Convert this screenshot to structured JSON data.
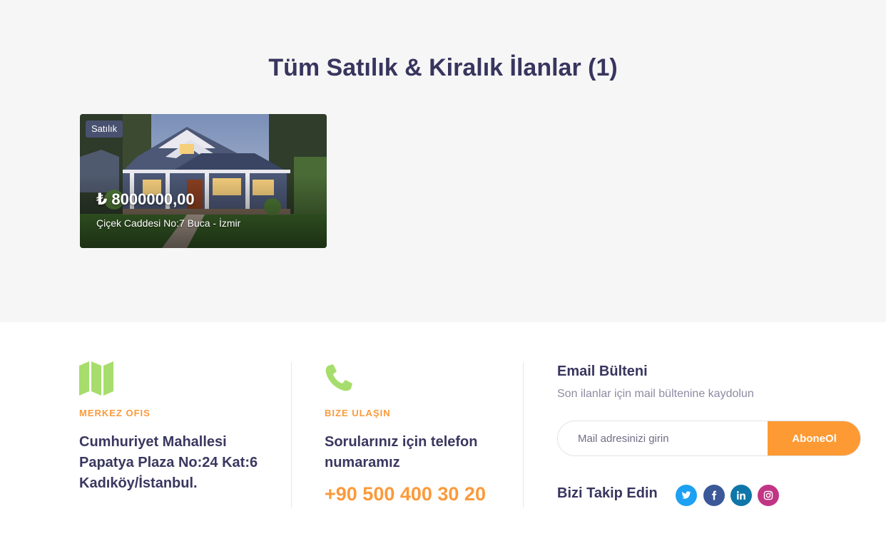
{
  "listings_section": {
    "title": "Tüm Satılık & Kiralık İlanlar (1)",
    "listings": [
      {
        "badge": "Satılık",
        "price": "₺ 8000000,00",
        "address": "Çiçek Caddesi No:7 Buca - İzmir"
      }
    ]
  },
  "footer": {
    "office": {
      "icon": "map-icon",
      "label": "MERKEZ OFIS",
      "address_lines": [
        "Cumhuriyet Mahallesi",
        "Papatya Plaza No:24 Kat:6",
        "Kadıköy/İstanbul."
      ]
    },
    "contact": {
      "icon": "phone-icon",
      "label": "BIZE ULAŞIN",
      "text_lines": [
        "Sorularınız için telefon",
        "numaramız"
      ],
      "phone": "+90 500 400 30 20"
    },
    "newsletter": {
      "title": "Email Bülteni",
      "subtitle": "Son ilanlar için mail bültenine kaydolun",
      "placeholder": "Mail adresinizi girin",
      "button": "AboneOl"
    },
    "follow": {
      "title": "Bizi Takip Edin",
      "networks": [
        {
          "icon": "twitter-icon",
          "color": "#1da1f2"
        },
        {
          "icon": "facebook-icon",
          "color": "#3b5998"
        },
        {
          "icon": "linkedin-icon",
          "color": "#0e76a8"
        },
        {
          "icon": "instagram-icon",
          "color": "#c13584"
        }
      ]
    }
  },
  "colors": {
    "accent_orange": "#fb9a3b",
    "icon_green": "#a6dd6c",
    "heading": "#38355e",
    "top_background": "#f6f6f6"
  }
}
